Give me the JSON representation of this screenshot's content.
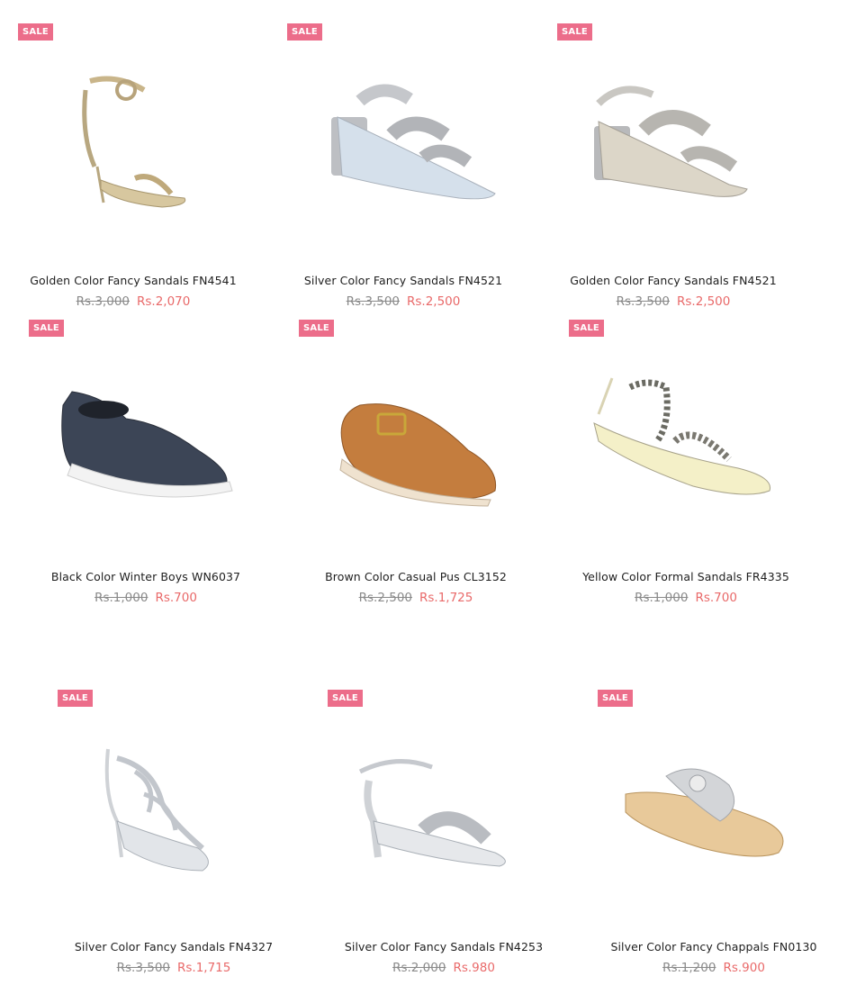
{
  "colors": {
    "badge": "#ec6d8a",
    "sale_price": "#e96a6a",
    "old_price": "#8a8a8a"
  },
  "products": [
    {
      "badge": "SALE",
      "name": "Golden Color Fancy Sandals FN4541",
      "old_price": "Rs.3,000",
      "price": "Rs.2,070",
      "image": "golden-heel-sandal-image"
    },
    {
      "badge": "SALE",
      "name": "Silver Color Fancy Sandals FN4521",
      "old_price": "Rs.3,500",
      "price": "Rs.2,500",
      "image": "silver-block-heel-sandal-image"
    },
    {
      "badge": "SALE",
      "name": "Golden Color Fancy Sandals FN4521",
      "old_price": "Rs.3,500",
      "price": "Rs.2,500",
      "image": "golden-block-heel-sandal-image"
    },
    {
      "badge": "SALE",
      "name": "Black Color Winter Boys WN6037",
      "old_price": "Rs.1,000",
      "price": "Rs.700",
      "image": "black-slip-on-shoe-image"
    },
    {
      "badge": "SALE",
      "name": "Brown Color Casual Pus CL3152",
      "old_price": "Rs.2,500",
      "price": "Rs.1,725",
      "image": "brown-slide-sandal-image"
    },
    {
      "badge": "SALE",
      "name": "Yellow Color Formal Sandals FR4335",
      "old_price": "Rs.1,000",
      "price": "Rs.700",
      "image": "yellow-flat-sandal-image"
    },
    {
      "badge": "SALE",
      "name": "Silver Color Fancy Sandals FN4327",
      "old_price": "Rs.3,500",
      "price": "Rs.1,715",
      "image": "silver-cage-heel-image"
    },
    {
      "badge": "SALE",
      "name": "Silver Color Fancy Sandals FN4253",
      "old_price": "Rs.2,000",
      "price": "Rs.980",
      "image": "silver-heel-sandal-image"
    },
    {
      "badge": "SALE",
      "name": "Silver Color Fancy Chappals FN0130",
      "old_price": "Rs.1,200",
      "price": "Rs.900",
      "image": "silver-flat-chappal-image"
    }
  ]
}
